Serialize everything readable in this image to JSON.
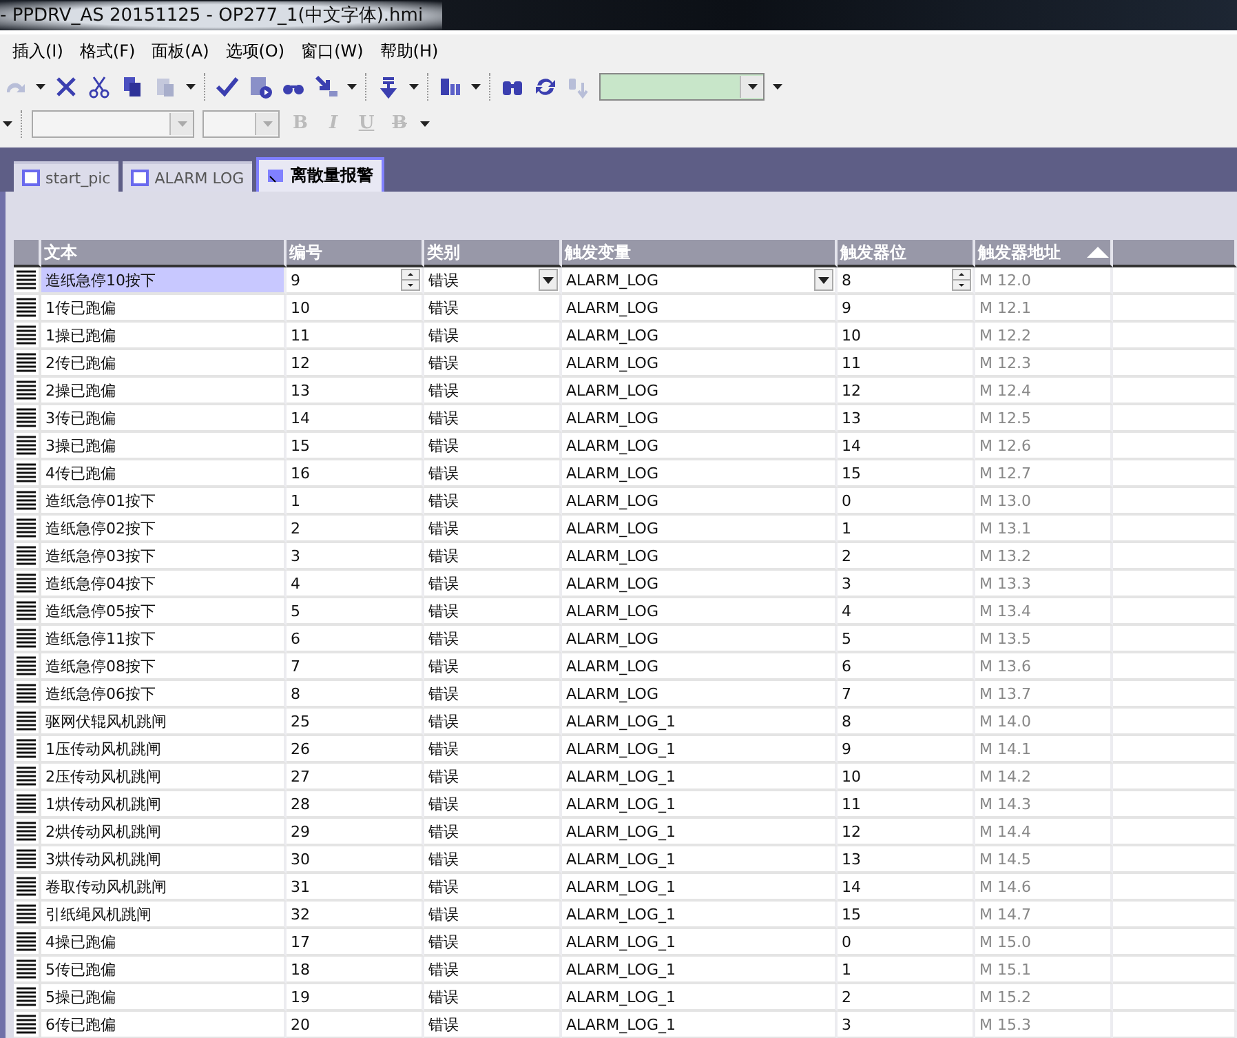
{
  "window": {
    "title": "- PPDRV_AS 20151125 - OP277_1(中文字体).hmi"
  },
  "menu": [
    "插入(I)",
    "格式(F)",
    "面板(A)",
    "选项(O)",
    "窗口(W)",
    "帮助(H)"
  ],
  "format_bar": {
    "buttons": [
      {
        "label": "B",
        "disabled": true
      },
      {
        "label": "I",
        "disabled": true
      },
      {
        "label": "U",
        "disabled": true
      },
      {
        "label": "B",
        "disabled": true
      }
    ]
  },
  "tabs": [
    {
      "label": "start_pic",
      "selected": false
    },
    {
      "label": "ALARM LOG",
      "selected": false
    },
    {
      "label": "离散量报警",
      "selected": true
    }
  ],
  "table": {
    "columns": [
      {
        "label": "文本"
      },
      {
        "label": "编号"
      },
      {
        "label": "类别"
      },
      {
        "label": "触发变量"
      },
      {
        "label": "触发器位"
      },
      {
        "label": "触发器地址",
        "sorted": true
      }
    ],
    "rows": [
      {
        "selected": true,
        "cells": [
          "造纸急停10按下",
          "9",
          "错误",
          "ALARM_LOG",
          "8",
          "M 12.0"
        ]
      },
      {
        "selected": false,
        "cells": [
          "1传已跑偏",
          "10",
          "错误",
          "ALARM_LOG",
          "9",
          "M 12.1"
        ]
      },
      {
        "selected": false,
        "cells": [
          "1操已跑偏",
          "11",
          "错误",
          "ALARM_LOG",
          "10",
          "M 12.2"
        ]
      },
      {
        "selected": false,
        "cells": [
          "2传已跑偏",
          "12",
          "错误",
          "ALARM_LOG",
          "11",
          "M 12.3"
        ]
      },
      {
        "selected": false,
        "cells": [
          "2操已跑偏",
          "13",
          "错误",
          "ALARM_LOG",
          "12",
          "M 12.4"
        ]
      },
      {
        "selected": false,
        "cells": [
          "3传已跑偏",
          "14",
          "错误",
          "ALARM_LOG",
          "13",
          "M 12.5"
        ]
      },
      {
        "selected": false,
        "cells": [
          "3操已跑偏",
          "15",
          "错误",
          "ALARM_LOG",
          "14",
          "M 12.6"
        ]
      },
      {
        "selected": false,
        "cells": [
          "4传已跑偏",
          "16",
          "错误",
          "ALARM_LOG",
          "15",
          "M 12.7"
        ]
      },
      {
        "selected": false,
        "cells": [
          "造纸急停01按下",
          "1",
          "错误",
          "ALARM_LOG",
          "0",
          "M 13.0"
        ]
      },
      {
        "selected": false,
        "cells": [
          "造纸急停02按下",
          "2",
          "错误",
          "ALARM_LOG",
          "1",
          "M 13.1"
        ]
      },
      {
        "selected": false,
        "cells": [
          "造纸急停03按下",
          "3",
          "错误",
          "ALARM_LOG",
          "2",
          "M 13.2"
        ]
      },
      {
        "selected": false,
        "cells": [
          "造纸急停04按下",
          "4",
          "错误",
          "ALARM_LOG",
          "3",
          "M 13.3"
        ]
      },
      {
        "selected": false,
        "cells": [
          "造纸急停05按下",
          "5",
          "错误",
          "ALARM_LOG",
          "4",
          "M 13.4"
        ]
      },
      {
        "selected": false,
        "cells": [
          "造纸急停11按下",
          "6",
          "错误",
          "ALARM_LOG",
          "5",
          "M 13.5"
        ]
      },
      {
        "selected": false,
        "cells": [
          "造纸急停08按下",
          "7",
          "错误",
          "ALARM_LOG",
          "6",
          "M 13.6"
        ]
      },
      {
        "selected": false,
        "cells": [
          "造纸急停06按下",
          "8",
          "错误",
          "ALARM_LOG",
          "7",
          "M 13.7"
        ]
      },
      {
        "selected": false,
        "cells": [
          "驱网伏辊风机跳闸",
          "25",
          "错误",
          "ALARM_LOG_1",
          "8",
          "M 14.0"
        ]
      },
      {
        "selected": false,
        "cells": [
          "1压传动风机跳闸",
          "26",
          "错误",
          "ALARM_LOG_1",
          "9",
          "M 14.1"
        ]
      },
      {
        "selected": false,
        "cells": [
          "2压传动风机跳闸",
          "27",
          "错误",
          "ALARM_LOG_1",
          "10",
          "M 14.2"
        ]
      },
      {
        "selected": false,
        "cells": [
          "1烘传动风机跳闸",
          "28",
          "错误",
          "ALARM_LOG_1",
          "11",
          "M 14.3"
        ]
      },
      {
        "selected": false,
        "cells": [
          "2烘传动风机跳闸",
          "29",
          "错误",
          "ALARM_LOG_1",
          "12",
          "M 14.4"
        ]
      },
      {
        "selected": false,
        "cells": [
          "3烘传动风机跳闸",
          "30",
          "错误",
          "ALARM_LOG_1",
          "13",
          "M 14.5"
        ]
      },
      {
        "selected": false,
        "cells": [
          "卷取传动风机跳闸",
          "31",
          "错误",
          "ALARM_LOG_1",
          "14",
          "M 14.6"
        ]
      },
      {
        "selected": false,
        "cells": [
          "引纸绳风机跳闸",
          "32",
          "错误",
          "ALARM_LOG_1",
          "15",
          "M 14.7"
        ]
      },
      {
        "selected": false,
        "cells": [
          "4操已跑偏",
          "17",
          "错误",
          "ALARM_LOG_1",
          "0",
          "M 15.0"
        ]
      },
      {
        "selected": false,
        "cells": [
          "5传已跑偏",
          "18",
          "错误",
          "ALARM_LOG_1",
          "1",
          "M 15.1"
        ]
      },
      {
        "selected": false,
        "cells": [
          "5操已跑偏",
          "19",
          "错误",
          "ALARM_LOG_1",
          "2",
          "M 15.2"
        ]
      },
      {
        "selected": false,
        "cells": [
          "6传已跑偏",
          "20",
          "错误",
          "ALARM_LOG_1",
          "3",
          "M 15.3"
        ]
      }
    ]
  }
}
